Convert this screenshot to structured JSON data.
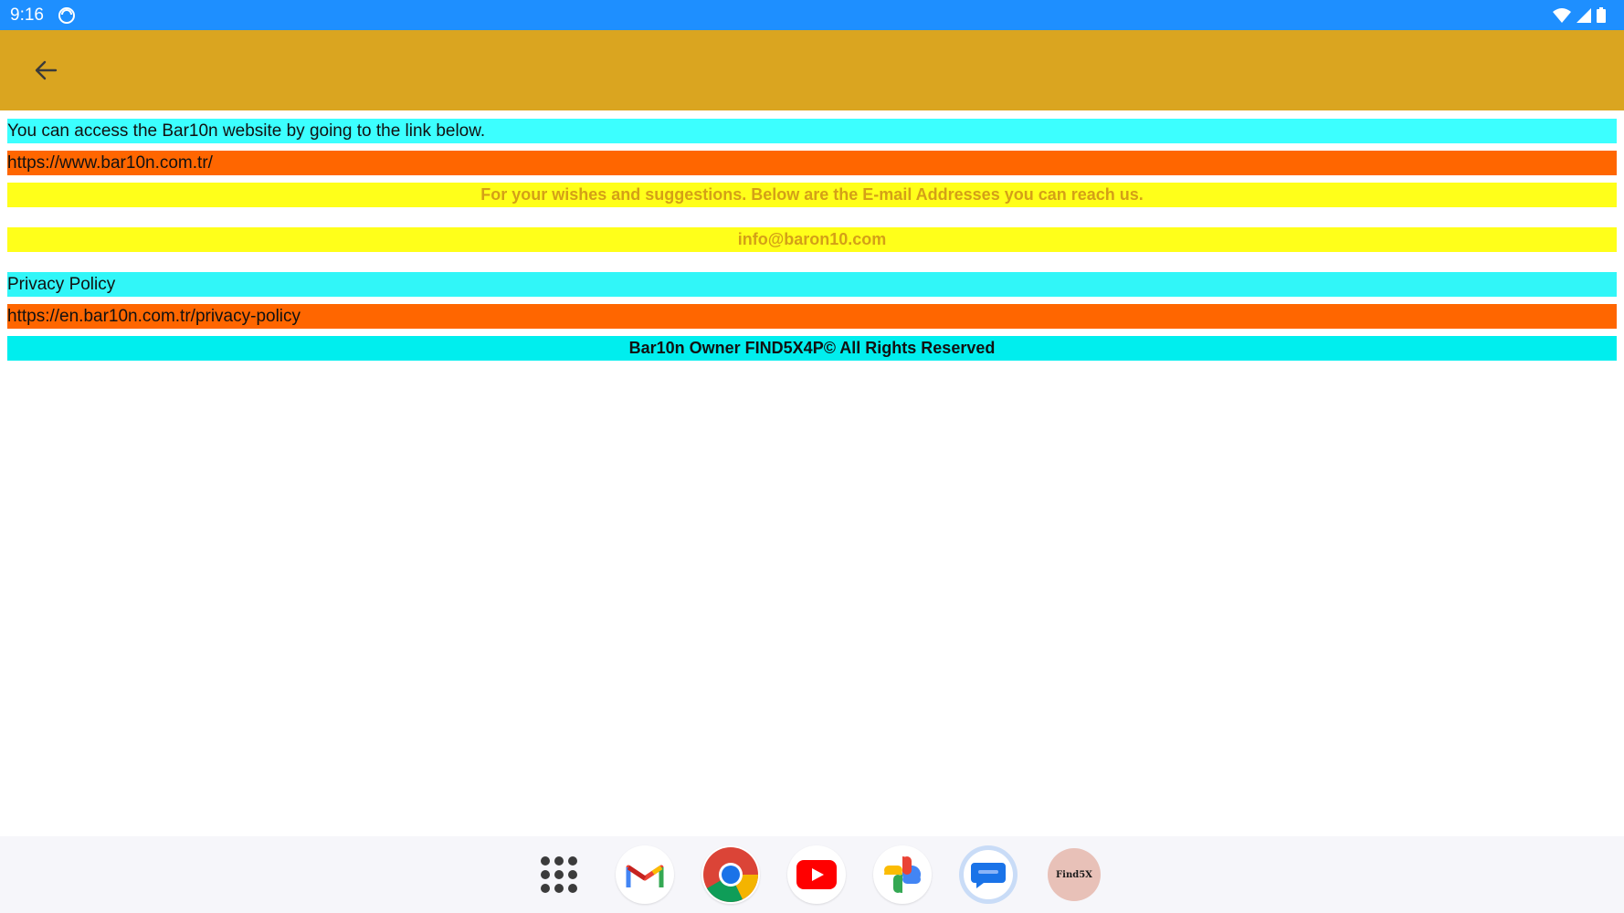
{
  "status_bar": {
    "time": "9:16",
    "icons": [
      "sync-icon",
      "wifi-icon",
      "signal-icon",
      "battery-icon"
    ]
  },
  "app_bar": {
    "back_icon": "arrow-left-icon",
    "color": "#daa520"
  },
  "content": {
    "website_intro": "You can access the Bar10n website by going to the link below.",
    "website_link": "https://www.bar10n.com.tr/",
    "wishes_text": "For your wishes and suggestions. Below are the E-mail Addresses you can reach us.",
    "email": "info@baron10.com",
    "privacy_title": "Privacy Policy",
    "privacy_link": "https://en.bar10n.com.tr/privacy-policy",
    "footer": "Bar10n Owner FIND5X4P© All Rights Reserved"
  },
  "colors": {
    "status_bar": "#1e8fff",
    "cyan": "#3cffff",
    "orange": "#ff6600",
    "yellow": "#ffff1a",
    "yellow_text": "#d4a017"
  },
  "dock": {
    "apps": [
      {
        "name": "app-drawer-icon"
      },
      {
        "name": "gmail-icon"
      },
      {
        "name": "chrome-icon"
      },
      {
        "name": "youtube-icon"
      },
      {
        "name": "photos-icon"
      },
      {
        "name": "messages-icon"
      },
      {
        "name": "find5x-app-icon",
        "label": "Find5X"
      }
    ]
  }
}
